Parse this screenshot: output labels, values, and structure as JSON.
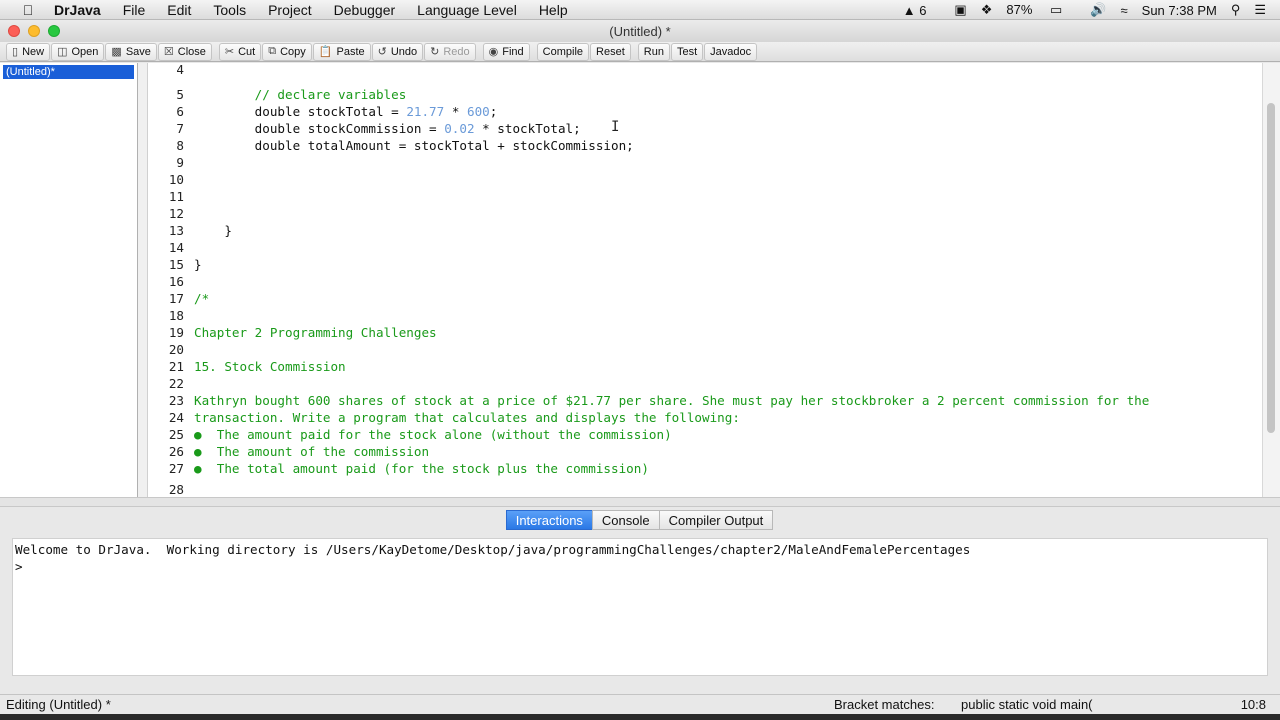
{
  "menubar": {
    "app_name": "DrJava",
    "menus": [
      "File",
      "Edit",
      "Tools",
      "Project",
      "Debugger",
      "Language Level",
      "Help"
    ],
    "status": {
      "adobe": "6",
      "battery": "87%",
      "clock": "Sun 7:38 PM"
    }
  },
  "window": {
    "title": "(Untitled) *"
  },
  "toolbar": {
    "new": "New",
    "open": "Open",
    "save": "Save",
    "close": "Close",
    "cut": "Cut",
    "copy": "Copy",
    "paste": "Paste",
    "undo": "Undo",
    "redo": "Redo",
    "find": "Find",
    "compile": "Compile",
    "reset": "Reset",
    "run": "Run",
    "test": "Test",
    "javadoc": "Javadoc"
  },
  "documents": [
    "(Untitled)*"
  ],
  "editor": {
    "lines": [
      {
        "n": "4",
        "text": ""
      },
      {
        "n": "5",
        "text": "        // declare variables"
      },
      {
        "n": "6",
        "text": "        double stockTotal = 21.77 * 600;"
      },
      {
        "n": "7",
        "text": "        double stockCommission = 0.02 * stockTotal;"
      },
      {
        "n": "8",
        "text": "        double totalAmount = stockTotal + stockCommission;"
      },
      {
        "n": "9",
        "text": ""
      },
      {
        "n": "10",
        "text": ""
      },
      {
        "n": "11",
        "text": ""
      },
      {
        "n": "12",
        "text": ""
      },
      {
        "n": "13",
        "text": "    }"
      },
      {
        "n": "14",
        "text": ""
      },
      {
        "n": "15",
        "text": "}"
      },
      {
        "n": "16",
        "text": ""
      },
      {
        "n": "17",
        "text": "/*"
      },
      {
        "n": "18",
        "text": ""
      },
      {
        "n": "19",
        "text": "Chapter 2 Programming Challenges"
      },
      {
        "n": "20",
        "text": ""
      },
      {
        "n": "21",
        "text": "15. Stock Commission"
      },
      {
        "n": "22",
        "text": ""
      },
      {
        "n": "23",
        "text": "Kathryn bought 600 shares of stock at a price of $21.77 per share. She must pay her stockbroker a 2 percent commission for the"
      },
      {
        "n": "24",
        "text": "transaction. Write a program that calculates and displays the following:"
      },
      {
        "n": "25",
        "text": "●  The amount paid for the stock alone (without the commission)"
      },
      {
        "n": "26",
        "text": "●  The amount of the commission"
      },
      {
        "n": "27",
        "text": "●  The total amount paid (for the stock plus the commission)"
      },
      {
        "n": "28",
        "text": ""
      }
    ],
    "colors": {
      "comment": "#1a9a1a",
      "number": "#6a9ad8"
    }
  },
  "tabs": {
    "interactions": "Interactions",
    "console": "Console",
    "compiler_output": "Compiler Output"
  },
  "interactions": {
    "welcome": "Welcome to DrJava.  Working directory is /Users/KayDetome/Desktop/java/programmingChallenges/chapter2/MaleAndFemalePercentages",
    "prompt": ">"
  },
  "statusbar": {
    "editing": "Editing (Untitled) *",
    "bracket_label": "Bracket matches:",
    "bracket_value": "public static void main(",
    "position": "10:8"
  }
}
